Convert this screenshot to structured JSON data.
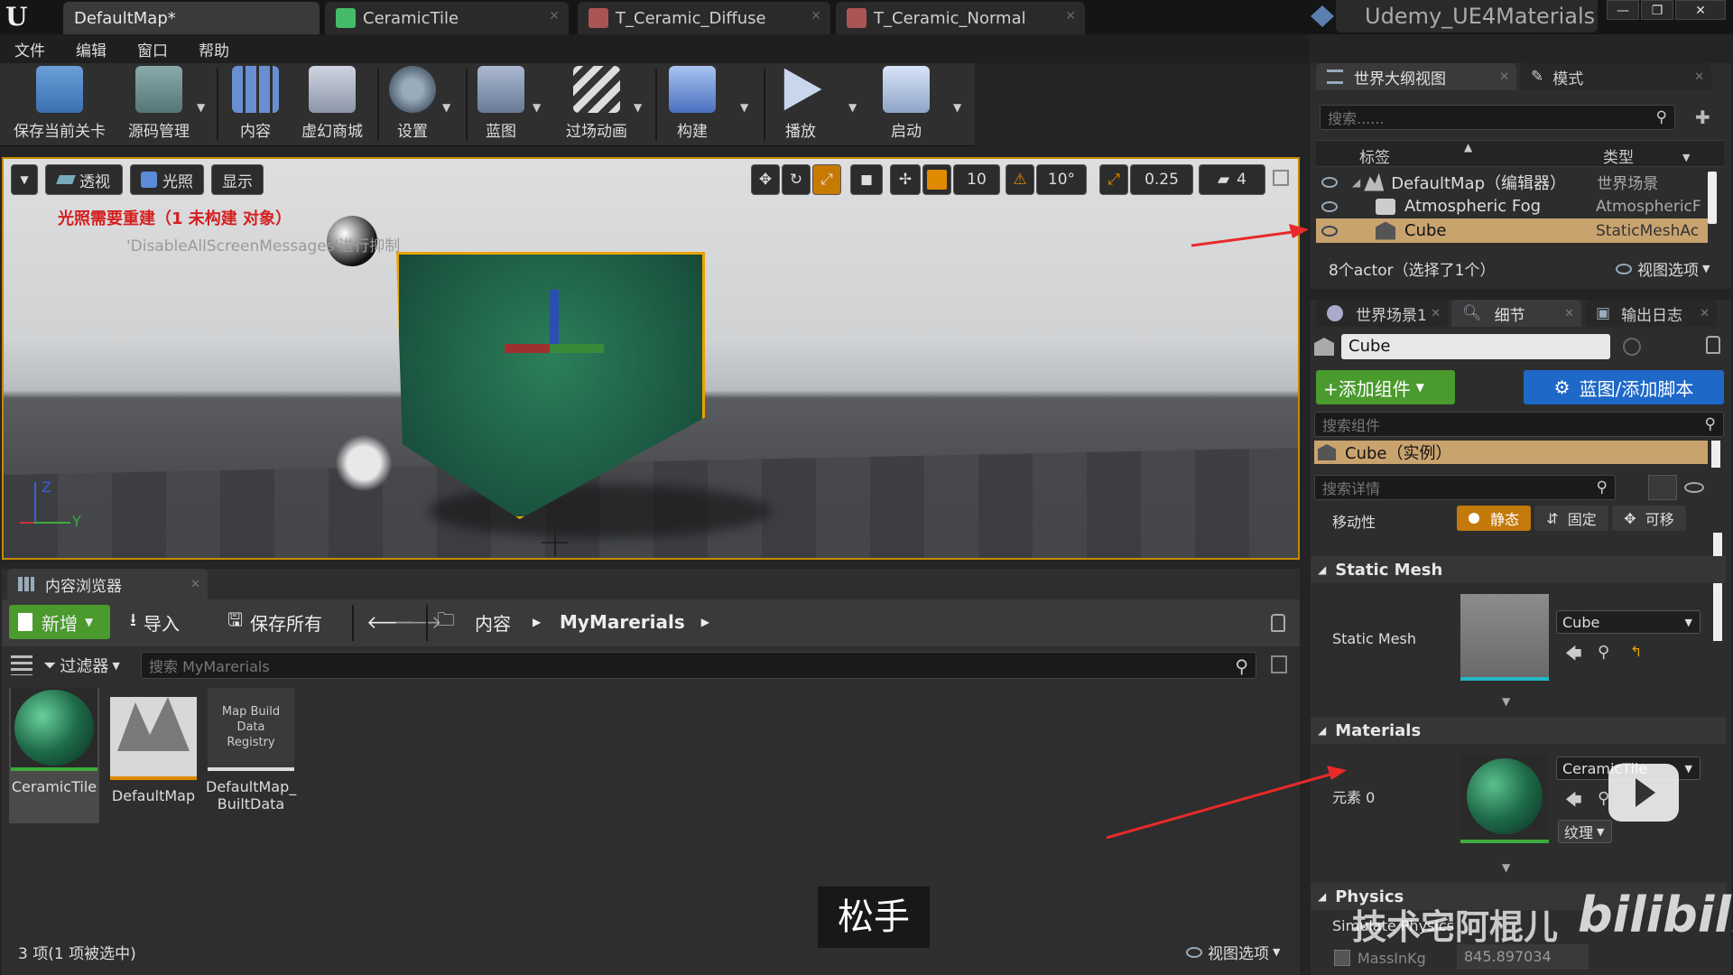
{
  "title_bar": {
    "tabs": [
      {
        "label": "DefaultMap*"
      },
      {
        "label": "CeramicTile"
      },
      {
        "label": "T_Ceramic_Diffuse"
      },
      {
        "label": "T_Ceramic_Normal"
      }
    ],
    "project_name": "Udemy_UE4Materials",
    "logo": "U"
  },
  "menu": [
    "文件",
    "编辑",
    "窗口",
    "帮助"
  ],
  "toolbar": {
    "buttons": [
      "保存当前关卡",
      "源码管理",
      "内容",
      "虚幻商城",
      "设置",
      "蓝图",
      "过场动画",
      "构建",
      "播放",
      "启动"
    ]
  },
  "viewport": {
    "perspective_label": "透视",
    "lighting_label": "光照",
    "show_label": "显示",
    "grid_snap": "10",
    "rotation_snap": "10°",
    "scale_snap": "0.25",
    "camera_speed": "4",
    "warning_text": "光照需要重建（1 未构建 对象）",
    "disable_msg": "'DisableAllScreenMessages'进行抑制",
    "axis_z": "Z",
    "axis_y": "Y"
  },
  "outliner": {
    "tab_label": "世界大纲视图",
    "modes_tab_label": "模式",
    "search_placeholder": "搜索......",
    "col_label": "标签",
    "col_type": "类型",
    "rows": [
      {
        "label": "DefaultMap（编辑器）",
        "type": "世界场景"
      },
      {
        "label": "Atmospheric Fog",
        "type": "AtmosphericF"
      },
      {
        "label": "Cube",
        "type": "StaticMeshAc"
      }
    ],
    "status": "8个actor（选择了1个）",
    "view_options": "视图选项"
  },
  "details": {
    "tabs": [
      "世界场景1",
      "细节",
      "输出日志"
    ],
    "actor_name": "Cube",
    "add_component": "+添加组件",
    "blueprint_button": "蓝图/添加脚本",
    "search_components": "搜索组件",
    "instance_row": "Cube（实例）",
    "search_details": "搜索详情",
    "mobility_label": "移动性",
    "mobility_options": [
      "静态",
      "固定",
      "可移"
    ],
    "static_mesh_section": "Static Mesh",
    "static_mesh_label": "Static Mesh",
    "static_mesh_value": "Cube",
    "materials_section": "Materials",
    "element_label": "元素 0",
    "material_value": "CeramicTile",
    "texture_button": "纹理",
    "physics_section": "Physics",
    "simulate_label": "Simulate Physics",
    "massinkg_label": "MassInKg",
    "massinkg_value": "845.897034"
  },
  "content_browser": {
    "tab_label": "内容浏览器",
    "new_button": "新增",
    "import_button": "导入",
    "save_all_button": "保存所有",
    "path": [
      "内容",
      "MyMarerials"
    ],
    "filter_label": "过滤器",
    "search_placeholder": "搜索 MyMarerials",
    "assets": [
      {
        "name": "CeramicTile"
      },
      {
        "name": "DefaultMap"
      },
      {
        "name": "DefaultMap_\nBuiltData",
        "thumb_text": "Map Build Data Registry"
      }
    ],
    "status": "3 项(1 项被选中)",
    "view_options": "视图选项"
  },
  "overlay": {
    "subtitle": "松手",
    "watermark": "技术宅阿棍儿",
    "bili": "bilibili"
  }
}
